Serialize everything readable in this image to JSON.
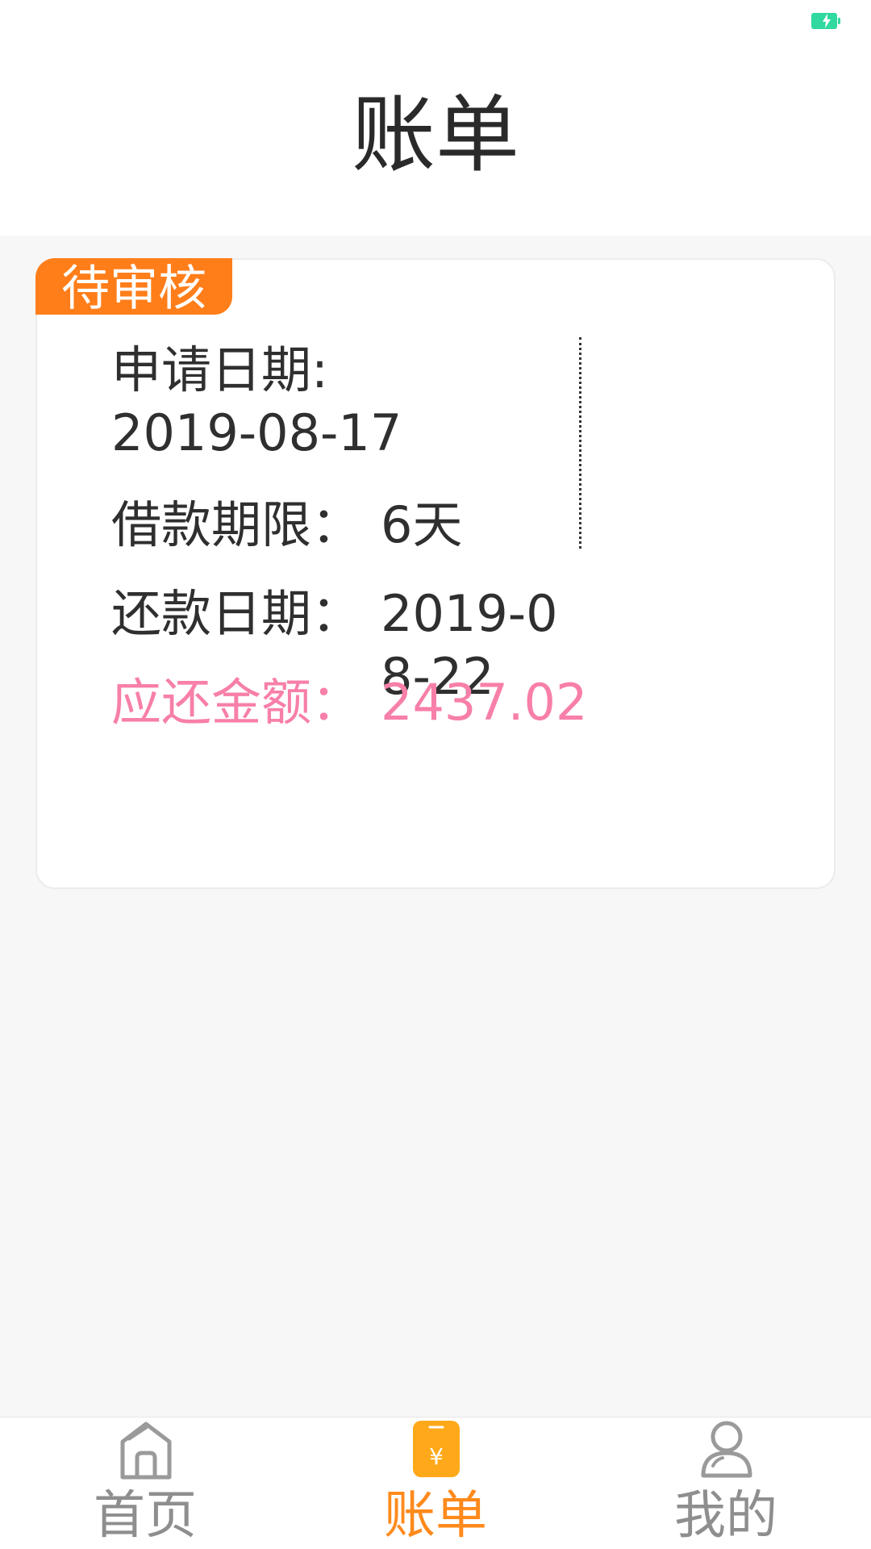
{
  "header": {
    "title": "账单"
  },
  "bill": {
    "status_badge": "待审核",
    "apply_date_label": "申请日期:",
    "apply_date_value": "2019-08-17",
    "term_label": "借款期限：",
    "term_value": "6天",
    "due_date_label": "还款日期：",
    "due_date_value": "2019-08-22",
    "amount_label": "应还金额：",
    "amount_value": "2437.02"
  },
  "tab_bar": {
    "items": [
      {
        "label": "首页",
        "icon": "home-icon",
        "active": false
      },
      {
        "label": "账单",
        "icon": "bill-icon",
        "active": true
      },
      {
        "label": "我的",
        "icon": "user-icon",
        "active": false
      }
    ]
  },
  "colors": {
    "accent": "#ff7e1a",
    "amount": "#f77fa9",
    "battery": "#2fd9a0",
    "inactive_tab": "#8e8e8e"
  }
}
